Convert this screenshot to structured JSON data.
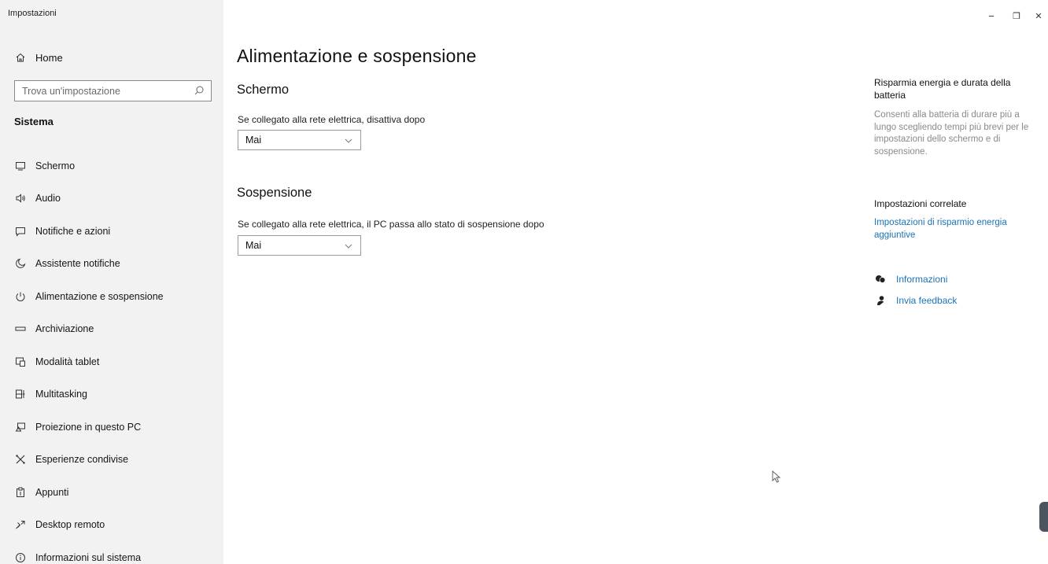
{
  "window": {
    "app_title": "Impostazioni",
    "controls": {
      "minimize": "−",
      "restore": "❐",
      "close": "✕"
    }
  },
  "sidebar": {
    "home_label": "Home",
    "search_placeholder": "Trova un'impostazione",
    "section_title": "Sistema",
    "items": [
      {
        "label": "Schermo",
        "icon": "monitor-icon"
      },
      {
        "label": "Audio",
        "icon": "speaker-icon"
      },
      {
        "label": "Notifiche e azioni",
        "icon": "notification-icon"
      },
      {
        "label": "Assistente notifiche",
        "icon": "moon-icon"
      },
      {
        "label": "Alimentazione e sospensione",
        "icon": "power-icon"
      },
      {
        "label": "Archiviazione",
        "icon": "storage-icon"
      },
      {
        "label": "Modalità tablet",
        "icon": "tablet-mode-icon"
      },
      {
        "label": "Multitasking",
        "icon": "multitasking-icon"
      },
      {
        "label": "Proiezione in questo PC",
        "icon": "projection-icon"
      },
      {
        "label": "Esperienze condivise",
        "icon": "shared-experiences-icon"
      },
      {
        "label": "Appunti",
        "icon": "clipboard-icon"
      },
      {
        "label": "Desktop remoto",
        "icon": "remote-desktop-icon"
      },
      {
        "label": "Informazioni sul sistema",
        "icon": "info-icon"
      }
    ]
  },
  "main": {
    "title": "Alimentazione e sospensione",
    "screen": {
      "heading": "Schermo",
      "label": "Se collegato alla rete elettrica, disattiva dopo",
      "value": "Mai"
    },
    "sleep": {
      "heading": "Sospensione",
      "label": "Se collegato alla rete elettrica, il PC passa allo stato di sospensione dopo",
      "value": "Mai"
    }
  },
  "right_panel": {
    "save_energy": {
      "heading": "Risparmia energia e durata della batteria",
      "text": "Consenti alla batteria di durare più a lungo scegliendo tempi più brevi per le impostazioni dello schermo e di sospensione."
    },
    "related": {
      "heading": "Impostazioni correlate",
      "link": "Impostazioni di risparmio energia aggiuntive"
    },
    "help": {
      "info": "Informazioni",
      "feedback": "Invia feedback"
    }
  },
  "colors": {
    "sidebar_bg": "#f2f2f2",
    "link": "#1a73b6",
    "muted_text": "#8a8a8a"
  }
}
